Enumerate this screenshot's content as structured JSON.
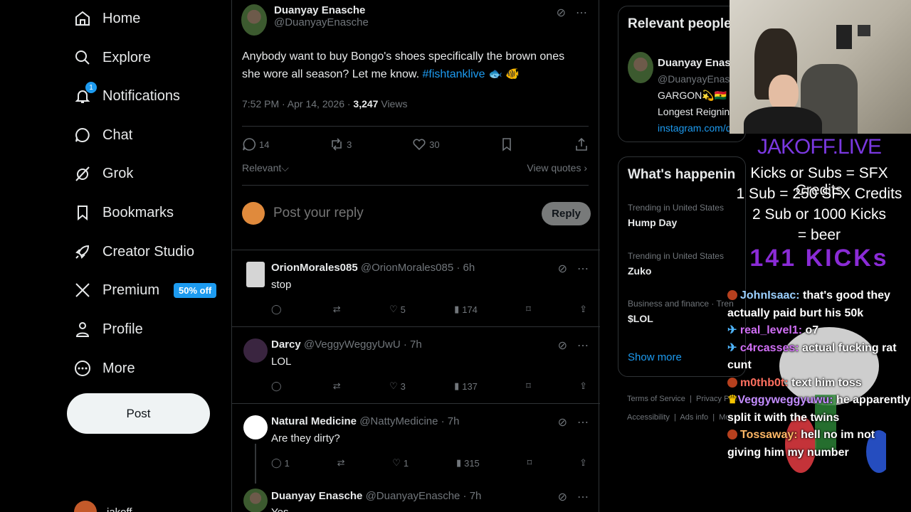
{
  "nav": {
    "items": [
      {
        "label": "Home",
        "icon": "home-icon"
      },
      {
        "label": "Explore",
        "icon": "search-icon"
      },
      {
        "label": "Notifications",
        "icon": "bell-icon",
        "badge": "1"
      },
      {
        "label": "Chat",
        "icon": "chat-icon"
      },
      {
        "label": "Grok",
        "icon": "grok-icon"
      },
      {
        "label": "Bookmarks",
        "icon": "bookmark-icon"
      },
      {
        "label": "Creator Studio",
        "icon": "rocket-icon"
      },
      {
        "label": "Premium",
        "icon": "x-logo-icon",
        "pill": "50% off"
      },
      {
        "label": "Profile",
        "icon": "person-icon"
      },
      {
        "label": "More",
        "icon": "more-icon"
      }
    ],
    "post_label": "Post",
    "account_name": "jakoff"
  },
  "tweet": {
    "name": "Duanyay Enasche",
    "handle": "@DuanyayEnasche",
    "text": "Anybody want to buy Bongo's shoes specifically the brown ones she wore all season? Let me know.",
    "hashtag": "#fishtanklive",
    "emoji": "🐟 🐠",
    "time": "7:52 PM · Apr 14, 2026 · ",
    "views_count": "3,247",
    "views_label": "Views",
    "replies": "14",
    "reposts": "3",
    "likes": "30",
    "sort_label": "Relevant",
    "view_quotes": "View quotes",
    "reply_placeholder": "Post your reply",
    "reply_button": "Reply"
  },
  "replies": [
    {
      "name": "OrionMorales085",
      "handle": "@OrionMorales085 · 6h",
      "text": "stop",
      "replies": "",
      "likes": "5",
      "views": "174"
    },
    {
      "name": "Darcy",
      "handle": "@VeggyWeggyUwU · 7h",
      "text": "LOL",
      "replies": "",
      "likes": "3",
      "views": "137"
    },
    {
      "name": "Natural Medicine",
      "handle": "@NattyMedicine · 7h",
      "text": "Are they dirty?",
      "replies": "1",
      "likes": "1",
      "views": "315"
    },
    {
      "name": "Duanyay Enasche",
      "handle": "@DuanyayEnasche · 7h",
      "text": "Yes"
    }
  ],
  "right": {
    "relevant_title": "Relevant people",
    "person_name": "Duanyay Enasch",
    "person_handle": "@DuanyayEnasc",
    "person_bio1": "GARGON💫🇬🇭",
    "person_bio2": "Longest Reigning",
    "person_link": "instagram.com/d",
    "happening_title": "What's happenin",
    "trends": [
      {
        "category": "Trending in United States",
        "name": "Hump Day"
      },
      {
        "category": "Trending in United States",
        "name": "Zuko"
      },
      {
        "category": "Business and finance · Tren",
        "name": "$LOL"
      }
    ],
    "show_more": "Show more",
    "footer1": "Terms of Service  |  Privacy Poli",
    "footer2": "Accessibility  |  Ads info  |  Mo"
  },
  "overlay": {
    "title": "JAKOFF.LIVE",
    "line1": "Kicks or Subs = SFX Credits",
    "line2": "1 Sub = 250 SFX Credits",
    "line3": "2 Sub or 1000 Kicks",
    "line4": "= beer",
    "kicks": "141 KICKs",
    "chat": [
      {
        "user": "JohnIsaac:",
        "text": " that's good they actually paid burt his 50k"
      },
      {
        "user": "real_level1:",
        "text": " o7"
      },
      {
        "user": "c4rcasses:",
        "text": " actual fucking rat cunt"
      },
      {
        "user": "m0thb0t:",
        "text": " text him toss"
      },
      {
        "user": "Veggyweggyuwu:",
        "text": " he apparently split it with the twins"
      },
      {
        "user": "Tossaway:",
        "text": " hell no im not giving him my number"
      }
    ]
  }
}
